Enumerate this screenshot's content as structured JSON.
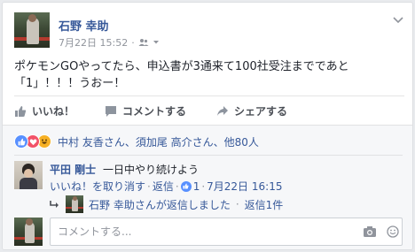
{
  "post": {
    "author": "石野 幸助",
    "timestamp": "7月22日 15:52",
    "text": "ポケモンGOやってたら、申込書が3通来て100社受注までであと「1」！！！うおー！"
  },
  "actions": {
    "like": "いいね！",
    "comment": "コメントする",
    "share": "シェアする"
  },
  "reactions": {
    "names": "中村 友香さん、須加尾 高介さん、他80人"
  },
  "comment": {
    "author": "平田 剛士",
    "text": "一日中やり続けよう",
    "unlike": "いいね！を取り消す",
    "reply": "返信",
    "like_count": "1",
    "time": "7月22日 16:15",
    "reply_summary": "石野 幸助さんが返信しました",
    "reply_count": "返信1件"
  },
  "compose": {
    "placeholder": "コメントする..."
  },
  "colors": {
    "link": "#365899",
    "like_blue": "#5890ff",
    "love_red": "#f25268",
    "haha_yellow": "#f7b125"
  },
  "icons": [
    "friends-icon",
    "chevron-down-icon",
    "like-icon",
    "comment-icon",
    "share-icon",
    "camera-icon",
    "emoji-icon"
  ]
}
